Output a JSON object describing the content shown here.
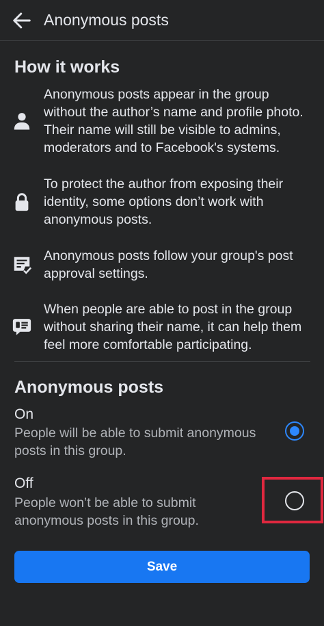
{
  "header": {
    "title": "Anonymous posts"
  },
  "how_it_works": {
    "title": "How it works",
    "items": [
      {
        "icon": "person-icon",
        "text": "Anonymous posts appear in the group without the author’s name and profile photo. Their name will still be visible to admins, moderators and to Facebook's systems."
      },
      {
        "icon": "lock-icon",
        "text": "To protect the author from exposing their identity, some options don’t work with anonymous posts."
      },
      {
        "icon": "approval-list-icon",
        "text": "Anonymous posts follow your group's post approval settings."
      },
      {
        "icon": "chat-bubble-icon",
        "text": "When people are able to post in the group without sharing their name, it can help them feel more comfortable participating."
      }
    ]
  },
  "setting": {
    "title": "Anonymous posts",
    "options": [
      {
        "label": "On",
        "description": "People will be able to submit anonymous posts in this group."
      },
      {
        "label": "Off",
        "description": "People won’t be able to submit anonymous posts in this group."
      }
    ],
    "selected": "On"
  },
  "save_label": "Save",
  "colors": {
    "background": "#242526",
    "accent": "#1877f2",
    "radio_selected": "#2d88ff",
    "highlight": "#e0283f"
  }
}
